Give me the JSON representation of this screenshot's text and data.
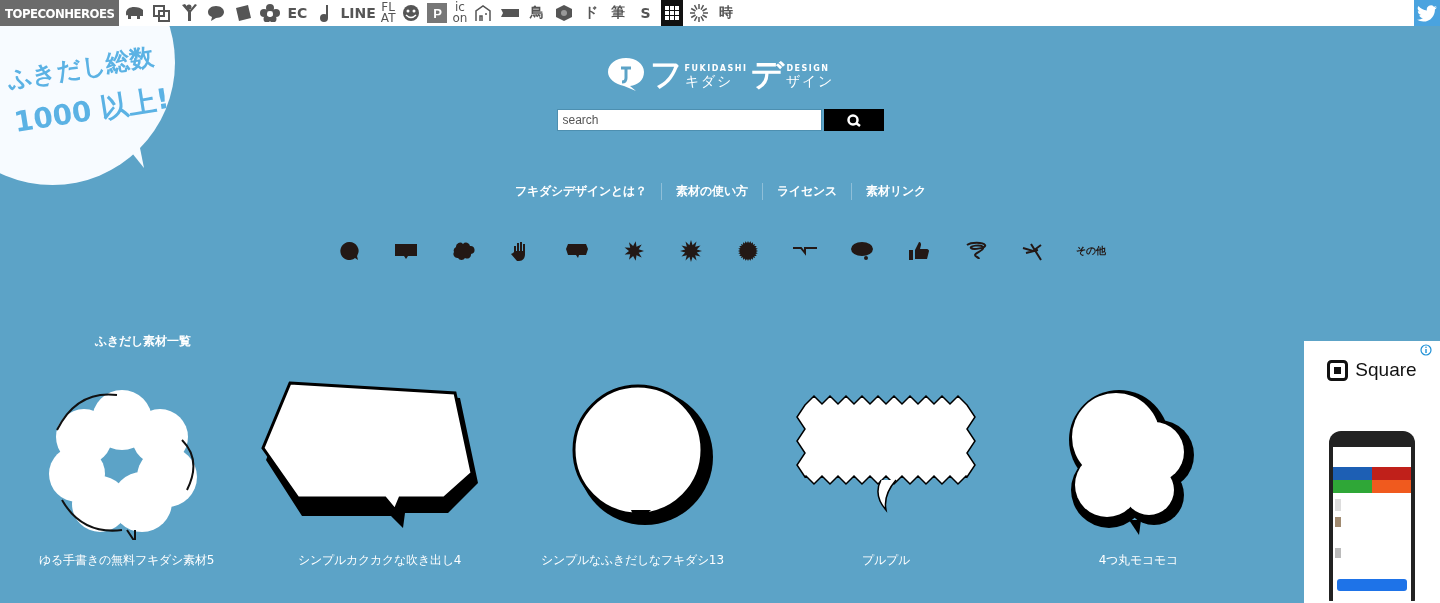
{
  "topbar": {
    "brand": "TOPECONHEROES",
    "items": [
      {
        "kind": "icon"
      },
      {
        "kind": "icon"
      },
      {
        "kind": "icon"
      },
      {
        "kind": "icon"
      },
      {
        "kind": "icon"
      },
      {
        "kind": "icon"
      },
      {
        "kind": "text",
        "label": "EC"
      },
      {
        "kind": "icon"
      },
      {
        "kind": "text",
        "label": "LINE"
      },
      {
        "kind": "stack",
        "label": "FL",
        "label2": "AT"
      },
      {
        "kind": "icon"
      },
      {
        "kind": "box",
        "label": "P"
      },
      {
        "kind": "stack",
        "label": "ic",
        "label2": "on"
      },
      {
        "kind": "icon"
      },
      {
        "kind": "icon"
      },
      {
        "kind": "text",
        "label": "鳥"
      },
      {
        "kind": "icon"
      },
      {
        "kind": "text",
        "label": "ド"
      },
      {
        "kind": "text",
        "label": "筆"
      },
      {
        "kind": "text",
        "label": "S"
      },
      {
        "kind": "dark"
      },
      {
        "kind": "icon"
      },
      {
        "kind": "text",
        "label": "時"
      }
    ]
  },
  "promo": {
    "line1": "ふきだし総数",
    "line2": "1000 以上!"
  },
  "logo": {
    "big1": "フ",
    "small1": "キダシ",
    "latin1": "FUKIDASHI",
    "big2": "デ",
    "small2": "ザイン",
    "latin2": "DESIGN"
  },
  "search": {
    "placeholder": "search"
  },
  "nav": [
    "フキダシデザインとは？",
    "素材の使い方",
    "ライセンス",
    "素材リンク"
  ],
  "categories": [
    {
      "kind": "icon"
    },
    {
      "kind": "icon"
    },
    {
      "kind": "icon"
    },
    {
      "kind": "icon"
    },
    {
      "kind": "icon"
    },
    {
      "kind": "icon"
    },
    {
      "kind": "icon"
    },
    {
      "kind": "icon"
    },
    {
      "kind": "icon"
    },
    {
      "kind": "icon"
    },
    {
      "kind": "icon"
    },
    {
      "kind": "icon"
    },
    {
      "kind": "icon"
    },
    {
      "kind": "text",
      "label": "その他"
    }
  ],
  "section_title": "ふきだし素材一覧",
  "items": [
    {
      "title": "ゆる手書きの無料フキダシ素材5"
    },
    {
      "title": "シンプルカクカクな吹き出し4"
    },
    {
      "title": "シンプルなふきだしなフキダシ13"
    },
    {
      "title": "プルプル"
    },
    {
      "title": "4つ丸モコモコ"
    }
  ],
  "ad": {
    "brand": "Square"
  }
}
